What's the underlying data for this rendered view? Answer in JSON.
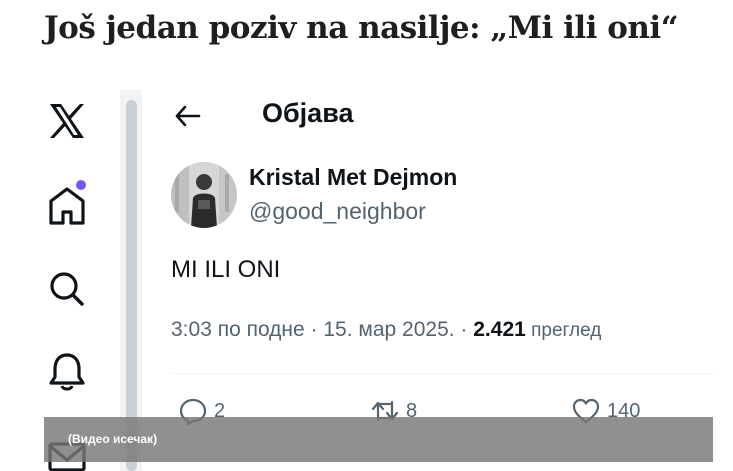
{
  "headline": "Još jedan poziv na nasilje: „Mi ili oni“",
  "sidebar": {
    "icons": [
      "x-logo-icon",
      "home-icon",
      "search-icon",
      "bell-icon",
      "mail-icon"
    ],
    "notification_dot_color": "#7856ff"
  },
  "post_header": {
    "title": "Објава",
    "back_icon": "back-arrow-icon"
  },
  "post": {
    "display_name": "Kristal Met Dejmon",
    "handle": "@good_neighbor",
    "text": "MI ILI ONI",
    "time": "3:03 по подне · 15. мар 2025. · ",
    "views_count": "2.421",
    "views_label": " преглед"
  },
  "actions": {
    "replies": "2",
    "reposts": "8",
    "likes": "140"
  },
  "caption": "(Видео исечак)",
  "colors": {
    "text_primary": "#0f1419",
    "text_secondary": "#536471",
    "caption_bar": "#7a7a7a"
  }
}
